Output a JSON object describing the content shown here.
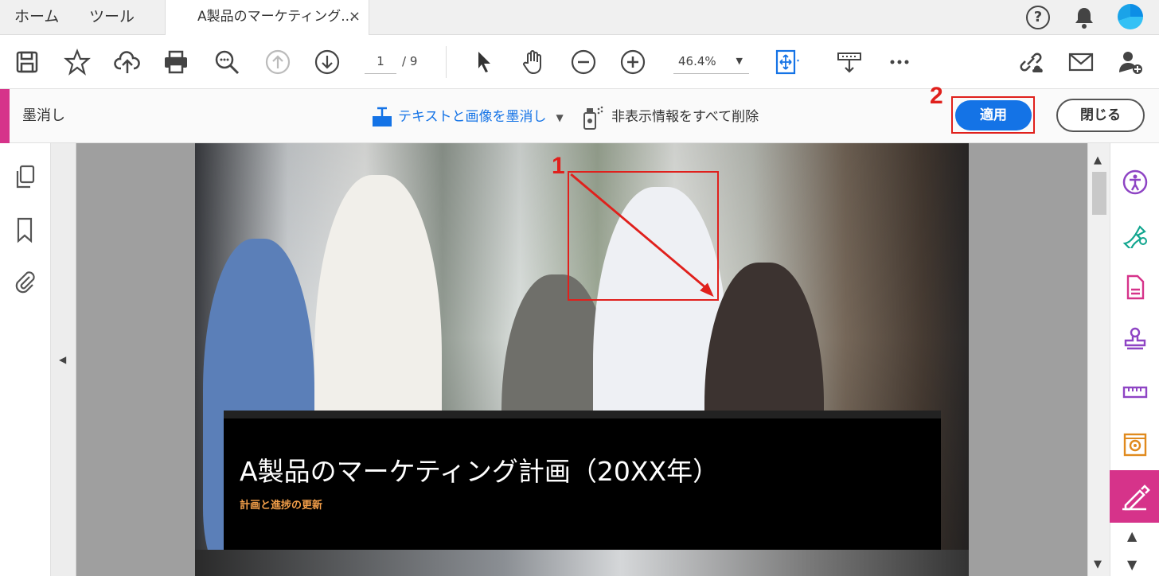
{
  "tabs": {
    "home": "ホーム",
    "tools": "ツール",
    "document": "A製品のマーケティング...",
    "close": "×"
  },
  "header_icons": [
    "help-icon",
    "bell-icon",
    "avatar"
  ],
  "help_glyph": "?",
  "toolbar": {
    "page_current": "1",
    "page_total": "/ 9",
    "zoom": "46.4%",
    "icons": [
      "save-icon",
      "star-icon",
      "upload-icon",
      "print-icon",
      "zoom-search-icon",
      "prev-page-icon",
      "next-page-icon",
      "select-cursor-icon",
      "hand-icon",
      "zoom-out-icon",
      "zoom-in-icon",
      "fit-page-icon",
      "scroll-mode-icon",
      "more-icon",
      "share-link-icon",
      "email-icon",
      "add-user-icon"
    ]
  },
  "redact": {
    "title": "墨消し",
    "tool_label": "テキストと画像を墨消し",
    "sanitize_label": "非表示情報をすべて削除",
    "apply": "適用",
    "close": "閉じる"
  },
  "annotations": {
    "step1": "1",
    "step2": "2"
  },
  "document": {
    "title": "A製品のマーケティング計画（20XX年）",
    "subtitle": "計画と進捗の更新"
  },
  "colors": {
    "accent_blue": "#1473e6",
    "redact_pink": "#d6338a",
    "annotation_red": "#e0201c",
    "subtitle_orange": "#f5a04a"
  }
}
